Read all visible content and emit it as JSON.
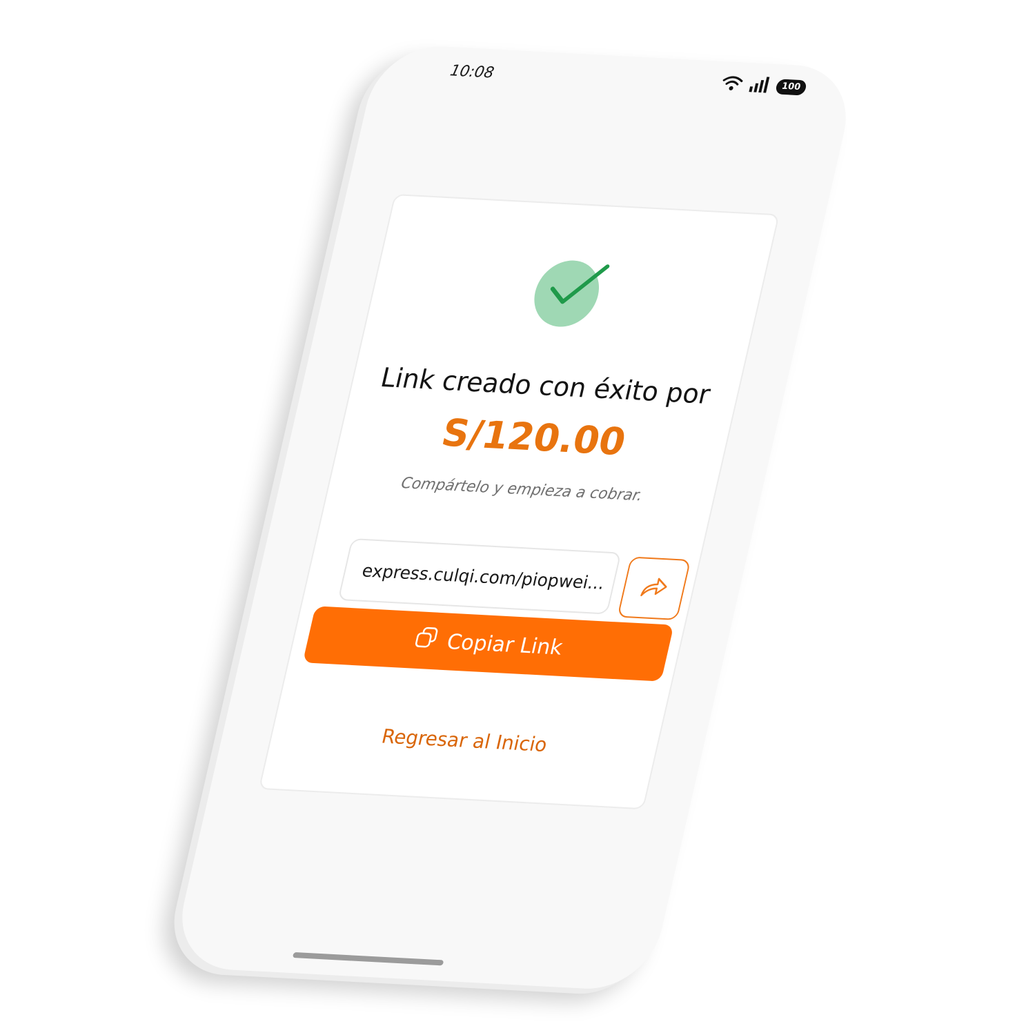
{
  "status_bar": {
    "time": "10:08",
    "battery": "100",
    "wifi_icon": "wifi-icon",
    "signal_icon": "signal-icon"
  },
  "success": {
    "icon": "check-circle-icon",
    "title": "Link creado con éxito por",
    "amount": "S/120.00",
    "subtitle": "Compártelo y empieza a cobrar."
  },
  "link": {
    "value": "express.culqi.com/piopwei...",
    "share_icon": "share-arrow-icon"
  },
  "actions": {
    "copy_label": "Copiar Link",
    "copy_icon": "copy-icon",
    "back_label": "Regresar al Inicio"
  },
  "colors": {
    "accent": "#ff6e05",
    "amount": "#e8740f",
    "success_bg": "#9fd8b4",
    "success_check": "#1f9a4a"
  }
}
